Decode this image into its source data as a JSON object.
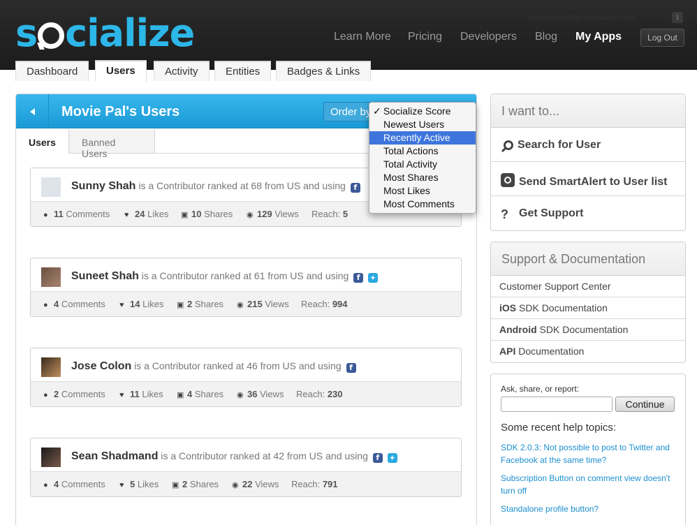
{
  "header": {
    "logo_text_left": "s",
    "logo_text_right": "cialize",
    "account_email": "developer@getsocialize.com",
    "nav": [
      "Learn More",
      "Pricing",
      "Developers",
      "Blog",
      "My Apps"
    ],
    "logout_label": "Log Out"
  },
  "subtabs": [
    "Dashboard",
    "Users",
    "Activity",
    "Entities",
    "Badges & Links"
  ],
  "panel": {
    "title": "Movie Pal's Users",
    "order_by_label": "Order by",
    "tabs": [
      "Users",
      "Banned Users"
    ]
  },
  "order_dropdown": {
    "check_mark": "✓",
    "options": [
      "Socialize Score",
      "Newest Users",
      "Recently Active",
      "Total Actions",
      "Total Activity",
      "Most Shares",
      "Most Likes",
      "Most Comments"
    ],
    "checked": "Socialize Score",
    "highlighted": "Recently Active"
  },
  "users": [
    {
      "name": "Sunny Shah",
      "desc": "is a Contributor ranked at 68 from US and using",
      "networks": [
        "facebook"
      ],
      "comments": "11",
      "comments_label": "Comments",
      "likes": "24",
      "likes_label": "Likes",
      "shares": "10",
      "shares_label": "Shares",
      "views": "129",
      "views_label": "Views",
      "reach_label": "Reach:",
      "reach": "5"
    },
    {
      "name": "Suneet Shah",
      "desc": "is a Contributor ranked at 61 from US and using",
      "networks": [
        "facebook",
        "twitter"
      ],
      "comments": "4",
      "comments_label": "Comments",
      "likes": "14",
      "likes_label": "Likes",
      "shares": "2",
      "shares_label": "Shares",
      "views": "215",
      "views_label": "Views",
      "reach_label": "Reach:",
      "reach": "994"
    },
    {
      "name": "Jose Colon",
      "desc": "is a Contributor ranked at 46 from US and using",
      "networks": [
        "facebook"
      ],
      "comments": "2",
      "comments_label": "Comments",
      "likes": "11",
      "likes_label": "Likes",
      "shares": "4",
      "shares_label": "Shares",
      "views": "36",
      "views_label": "Views",
      "reach_label": "Reach:",
      "reach": "230"
    },
    {
      "name": "Sean Shadmand",
      "desc": "is a Contributor ranked at 42 from US and using",
      "networks": [
        "facebook",
        "twitter"
      ],
      "comments": "4",
      "comments_label": "Comments",
      "likes": "5",
      "likes_label": "Likes",
      "shares": "2",
      "shares_label": "Shares",
      "views": "22",
      "views_label": "Views",
      "reach_label": "Reach:",
      "reach": "791"
    }
  ],
  "want_box": {
    "title": "I want to...",
    "items": [
      "Search for User",
      "Send SmartAlert to User list",
      "Get Support"
    ]
  },
  "docs_box": {
    "title": "Support & Documentation",
    "items": [
      {
        "bold": "",
        "text": "Customer Support Center"
      },
      {
        "bold": "iOS",
        "text": " SDK Documentation"
      },
      {
        "bold": "Android",
        "text": " SDK Documentation"
      },
      {
        "bold": "API",
        "text": " Documentation"
      }
    ]
  },
  "help_box": {
    "prompt": "Ask, share, or report:",
    "input_value": "",
    "button_label": "Continue",
    "topics_title": "Some recent help topics:",
    "topics": [
      "SDK 2.0.3: Not possible to post to Twitter and Facebook at the same time?",
      "Subscription Button on comment view doesn't turn off",
      "Standalone profile button?"
    ]
  },
  "colors": {
    "brand_blue": "#2db6e8",
    "header_bg": "#222222",
    "panel_head": "#1a9ad6",
    "link_blue": "#1c8fd0",
    "menu_highlight": "#3d75dc"
  }
}
